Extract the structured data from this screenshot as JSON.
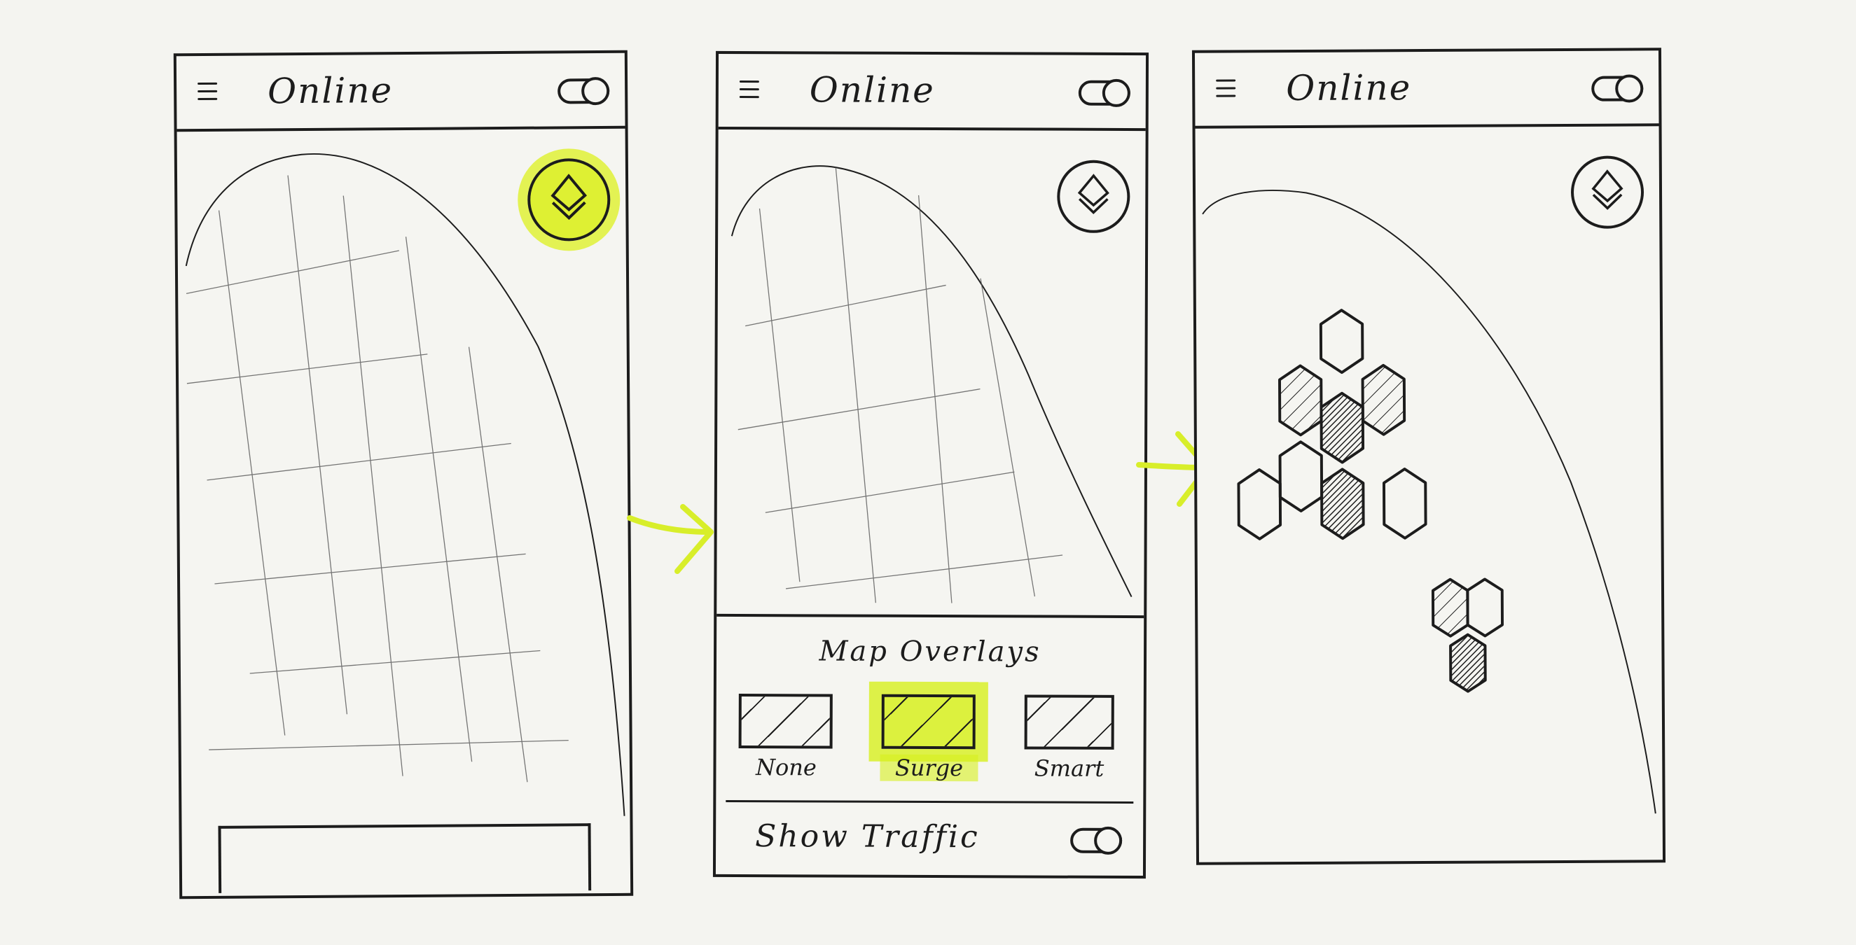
{
  "screens": [
    {
      "title": "Online",
      "menu_icon": "hamburger-menu-icon",
      "toggle_icon": "toggle-switch-icon",
      "layers_icon": "layers-icon",
      "layers_highlighted": true
    },
    {
      "title": "Online",
      "menu_icon": "hamburger-menu-icon",
      "toggle_icon": "toggle-switch-icon",
      "layers_icon": "layers-icon",
      "overlay_panel": {
        "title": "Map Overlays",
        "options": [
          {
            "label": "None",
            "selected": false
          },
          {
            "label": "Surge",
            "selected": true
          },
          {
            "label": "Smart",
            "selected": false
          }
        ],
        "traffic_label": "Show Traffic"
      }
    },
    {
      "title": "Online",
      "menu_icon": "hamburger-menu-icon",
      "toggle_icon": "toggle-switch-icon",
      "layers_icon": "layers-icon",
      "map_overlay": "surge-hexagons"
    }
  ],
  "colors": {
    "ink": "#1c1c1c",
    "paper": "#f4f4f0",
    "highlight": "#dcf01e"
  }
}
